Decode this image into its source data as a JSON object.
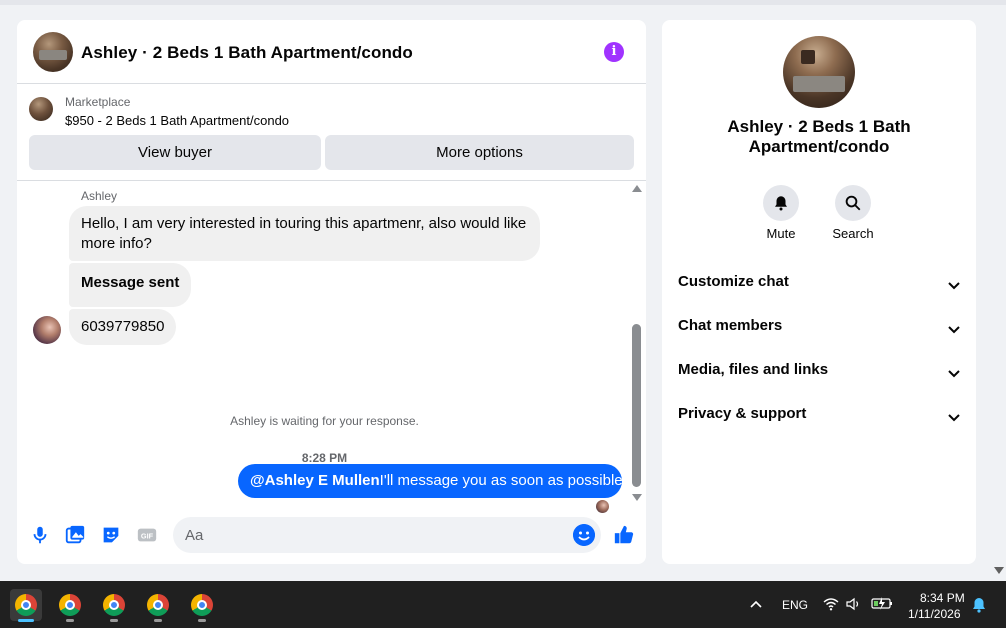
{
  "chat": {
    "title": "Ashley · 2 Beds 1 Bath Apartment/condo",
    "marketplace_label": "Marketplace",
    "listing": "$950 - 2 Beds 1 Bath Apartment/condo",
    "view_buyer_label": "View buyer",
    "more_options_label": "More options",
    "sender_name": "Ashley",
    "messages": [
      {
        "text": "Hello, I am very interested in touring this apartmenr, also would like more info?"
      },
      {
        "text": "Message sent"
      },
      {
        "text": "6039779850"
      }
    ],
    "waiting_notice": "Ashley is waiting for your response.",
    "timestamp": "8:28 PM",
    "outgoing": {
      "mention": "@Ashley E Mullen",
      "text": "I'll message you as soon as possible"
    },
    "composer_placeholder": "Aa"
  },
  "info_panel": {
    "title": "Ashley · 2 Beds 1 Bath Apartment/condo",
    "actions": [
      {
        "label": "Mute",
        "icon": "bell-icon"
      },
      {
        "label": "Search",
        "icon": "search-icon"
      }
    ],
    "sections": [
      {
        "label": "Customize chat"
      },
      {
        "label": "Chat members"
      },
      {
        "label": "Media, files and links"
      },
      {
        "label": "Privacy & support"
      }
    ]
  },
  "taskbar": {
    "language": "ENG",
    "time": "8:34 PM",
    "date": "1/11/2026"
  },
  "colors": {
    "accent": "#0866ff",
    "info": "#a033ff",
    "background": "#f0f2f5",
    "taskbar": "#202020"
  }
}
